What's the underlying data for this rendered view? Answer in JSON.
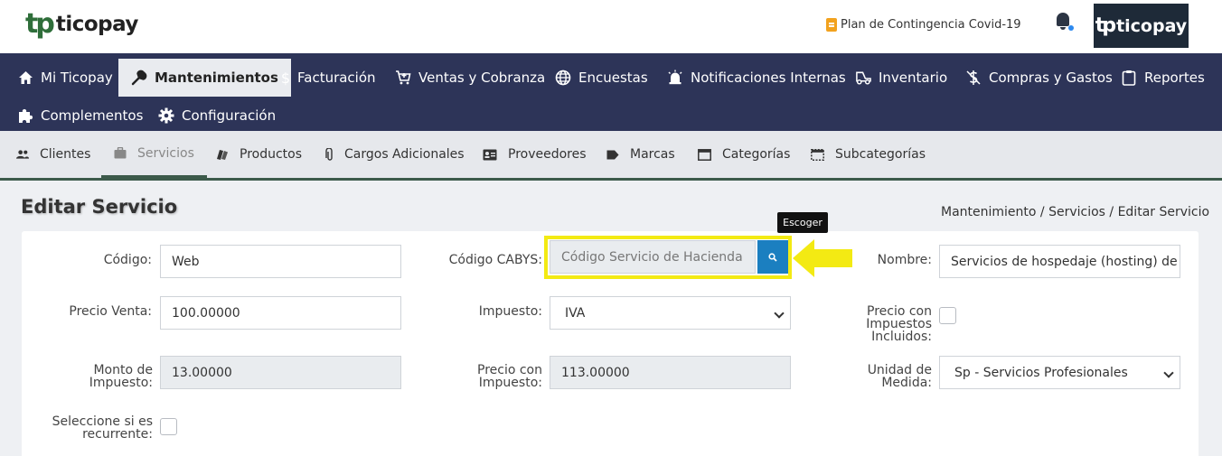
{
  "header": {
    "logo_mark": "tp",
    "logo_text": "ticopay",
    "covid_link": "Plan de Contingencia Covid-19",
    "avatar_mark": "tp",
    "avatar_text": "ticopay"
  },
  "main_nav": [
    {
      "label": "Mi Ticopay",
      "icon": "home-icon"
    },
    {
      "label": "Mantenimientos",
      "icon": "wrench-icon"
    },
    {
      "label": "Facturación",
      "icon": "dollar-icon"
    },
    {
      "label": "Ventas y Cobranza",
      "icon": "cart-plus-icon"
    },
    {
      "label": "Encuestas",
      "icon": "globe-icon"
    },
    {
      "label": "Notificaciones Internas",
      "icon": "alarm-icon"
    },
    {
      "label": "Inventario",
      "icon": "truck-icon"
    },
    {
      "label": "Compras y Gastos",
      "icon": "dollar-off-icon"
    },
    {
      "label": "Reportes",
      "icon": "clipboard-icon"
    },
    {
      "label": "Complementos",
      "icon": "puzzle-icon"
    },
    {
      "label": "Configuración",
      "icon": "gear-icon"
    }
  ],
  "sub_nav": [
    {
      "label": "Clientes",
      "icon": "people-icon"
    },
    {
      "label": "Servicios",
      "icon": "briefcase-icon"
    },
    {
      "label": "Productos",
      "icon": "boxes-icon"
    },
    {
      "label": "Cargos Adicionales",
      "icon": "paperclip-icon"
    },
    {
      "label": "Proveedores",
      "icon": "id-card-icon"
    },
    {
      "label": "Marcas",
      "icon": "tag-icon"
    },
    {
      "label": "Categorías",
      "icon": "window-icon"
    },
    {
      "label": "Subcategorías",
      "icon": "dashed-window-icon"
    }
  ],
  "page": {
    "title": "Editar Servicio",
    "breadcrumb": "Mantenimiento / Servicios / Editar Servicio",
    "tooltip": "Escoger"
  },
  "form": {
    "codigo_label": "Código:",
    "codigo_value": "Web",
    "cabys_label": "Código CABYS:",
    "cabys_placeholder": "Código Servicio de Hacienda",
    "nombre_label": "Nombre:",
    "nombre_value": "Servicios de hospedaje (hosting) de sitios web",
    "precio_venta_label": "Precio Venta:",
    "precio_venta_value": "100.00000",
    "impuesto_label": "Impuesto:",
    "impuesto_value": "IVA",
    "precio_incl_label_1": "Precio con",
    "precio_incl_label_2": "Impuestos",
    "precio_incl_label_3": "Incluidos:",
    "monto_label_1": "Monto de",
    "monto_label_2": "Impuesto:",
    "monto_value": "13.00000",
    "precio_con_label_1": "Precio con",
    "precio_con_label_2": "Impuesto:",
    "precio_con_value": "113.00000",
    "unidad_label_1": "Unidad de",
    "unidad_label_2": "Medida:",
    "unidad_value": "Sp - Servicios Profesionales",
    "recurrente_label_1": "Seleccione si es",
    "recurrente_label_2": "recurrente:"
  },
  "colors": {
    "nav_bg": "#2d3458",
    "subnav_bg": "#e6e8ec",
    "accent_green": "#3c5a4a",
    "button_blue": "#1b7fc0",
    "highlight_yellow": "#f3ea13"
  }
}
